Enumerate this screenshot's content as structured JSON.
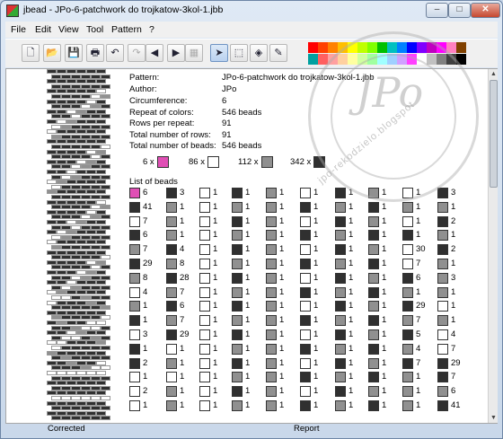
{
  "window": {
    "title": "jbead - JPo-6-patchwork do trojkatow-3kol-1.jbb",
    "min": "–",
    "max": "□",
    "close": "✕"
  },
  "menu": [
    {
      "label": "File"
    },
    {
      "label": "Edit"
    },
    {
      "label": "View"
    },
    {
      "label": "Tool"
    },
    {
      "label": "Pattern"
    },
    {
      "label": "?"
    }
  ],
  "toolbar": [
    {
      "name": "new-icon",
      "glyph": "🗋"
    },
    {
      "name": "open-icon",
      "glyph": "📂"
    },
    {
      "name": "save-icon",
      "glyph": "💾"
    },
    {
      "name": "print-icon",
      "glyph": "🖶"
    },
    {
      "name": "undo-icon",
      "glyph": "↶"
    },
    {
      "name": "redo-icon",
      "glyph": "↷"
    },
    {
      "name": "scroll-left-icon",
      "glyph": "◀"
    },
    {
      "name": "scroll-right-icon",
      "glyph": "▶"
    },
    {
      "name": "arrange-icon",
      "glyph": "▦"
    },
    {
      "name": "pointer-icon",
      "glyph": "➤"
    },
    {
      "name": "select-icon",
      "glyph": "⬚"
    },
    {
      "name": "fill-icon",
      "glyph": "◈"
    },
    {
      "name": "pipette-icon",
      "glyph": "✎"
    }
  ],
  "palette": [
    "#ff0000",
    "#ff4000",
    "#ff8000",
    "#ffbf00",
    "#ffff00",
    "#bfff00",
    "#80ff00",
    "#00c000",
    "#00c0c0",
    "#0080ff",
    "#0000ff",
    "#8000ff",
    "#c000c0",
    "#ff00ff",
    "#ff80c0",
    "#804000",
    "#00a0a0",
    "#ff6060",
    "#ffa0a0",
    "#ffd0a0",
    "#ffffa0",
    "#d0ffa0",
    "#a0ffa0",
    "#a0ffff",
    "#a0d0ff",
    "#d0a0ff",
    "#ff40ff",
    "#ffffff",
    "#c0c0c0",
    "#808080",
    "#404040",
    "#000000"
  ],
  "info": {
    "pattern_label": "Pattern:",
    "pattern": "JPo-6-patchwork do trojkatow-3kol-1.jbb",
    "author_label": "Author:",
    "author": "JPo",
    "circ_label": "Circumference:",
    "circ": "6",
    "repeat_label": "Repeat of colors:",
    "repeat": "546 beads",
    "rows_repeat_label": "Rows per repeat:",
    "rows_repeat": "91",
    "total_rows_label": "Total number of rows:",
    "total_rows": "91",
    "total_beads_label": "Total number of beads:",
    "total_beads": "546 beads"
  },
  "usage": [
    {
      "count": "6 x",
      "color": "#e04fb5"
    },
    {
      "count": "86 x",
      "color": "#ffffff"
    },
    {
      "count": "112 x",
      "color": "#909090"
    },
    {
      "count": "342 x",
      "color": "#303030"
    }
  ],
  "list_title": "List of beads",
  "bead_list": [
    [
      [
        "m",
        "6"
      ],
      [
        "k",
        "41"
      ],
      [
        "w",
        "7"
      ],
      [
        "k",
        "6"
      ],
      [
        "g",
        "7"
      ],
      [
        "k",
        "29"
      ],
      [
        "g",
        "8"
      ],
      [
        "w",
        "4"
      ],
      [
        "g",
        "1"
      ],
      [
        "k",
        "1"
      ],
      [
        "w",
        "3"
      ],
      [
        "k",
        "1"
      ],
      [
        "k",
        "2"
      ],
      [
        "w",
        "1"
      ],
      [
        "w",
        "2"
      ],
      [
        "w",
        "1"
      ]
    ],
    [
      [
        "k",
        "3"
      ],
      [
        "g",
        "1"
      ],
      [
        "g",
        "1"
      ],
      [
        "g",
        "1"
      ],
      [
        "k",
        "4"
      ],
      [
        "g",
        "8"
      ],
      [
        "k",
        "28"
      ],
      [
        "g",
        "7"
      ],
      [
        "k",
        "6"
      ],
      [
        "g",
        "7"
      ],
      [
        "k",
        "29"
      ],
      [
        "w",
        "1"
      ],
      [
        "g",
        "1"
      ],
      [
        "w",
        "1"
      ],
      [
        "g",
        "1"
      ],
      [
        "g",
        "1"
      ]
    ],
    [
      [
        "w",
        "1"
      ],
      [
        "w",
        "1"
      ],
      [
        "w",
        "1"
      ],
      [
        "w",
        "1"
      ],
      [
        "w",
        "1"
      ],
      [
        "w",
        "1"
      ],
      [
        "w",
        "1"
      ],
      [
        "w",
        "1"
      ],
      [
        "w",
        "1"
      ],
      [
        "w",
        "1"
      ],
      [
        "w",
        "1"
      ],
      [
        "w",
        "1"
      ],
      [
        "w",
        "1"
      ],
      [
        "w",
        "1"
      ],
      [
        "w",
        "1"
      ],
      [
        "w",
        "1"
      ]
    ],
    [
      [
        "k",
        "1"
      ],
      [
        "g",
        "1"
      ],
      [
        "k",
        "1"
      ],
      [
        "g",
        "1"
      ],
      [
        "k",
        "1"
      ],
      [
        "g",
        "1"
      ],
      [
        "k",
        "1"
      ],
      [
        "g",
        "1"
      ],
      [
        "k",
        "1"
      ],
      [
        "g",
        "1"
      ],
      [
        "k",
        "1"
      ],
      [
        "g",
        "1"
      ],
      [
        "k",
        "1"
      ],
      [
        "g",
        "1"
      ],
      [
        "k",
        "1"
      ],
      [
        "g",
        "1"
      ]
    ],
    [
      [
        "g",
        "1"
      ],
      [
        "g",
        "1"
      ],
      [
        "g",
        "1"
      ],
      [
        "g",
        "1"
      ],
      [
        "g",
        "1"
      ],
      [
        "g",
        "1"
      ],
      [
        "g",
        "1"
      ],
      [
        "g",
        "1"
      ],
      [
        "g",
        "1"
      ],
      [
        "g",
        "1"
      ],
      [
        "g",
        "1"
      ],
      [
        "g",
        "1"
      ],
      [
        "g",
        "1"
      ],
      [
        "g",
        "1"
      ],
      [
        "g",
        "1"
      ],
      [
        "g",
        "1"
      ]
    ],
    [
      [
        "w",
        "1"
      ],
      [
        "k",
        "1"
      ],
      [
        "w",
        "1"
      ],
      [
        "k",
        "1"
      ],
      [
        "w",
        "1"
      ],
      [
        "k",
        "1"
      ],
      [
        "w",
        "1"
      ],
      [
        "k",
        "1"
      ],
      [
        "w",
        "1"
      ],
      [
        "k",
        "1"
      ],
      [
        "w",
        "1"
      ],
      [
        "k",
        "1"
      ],
      [
        "w",
        "1"
      ],
      [
        "k",
        "1"
      ],
      [
        "w",
        "1"
      ],
      [
        "k",
        "1"
      ]
    ],
    [
      [
        "k",
        "1"
      ],
      [
        "g",
        "1"
      ],
      [
        "k",
        "1"
      ],
      [
        "g",
        "1"
      ],
      [
        "k",
        "1"
      ],
      [
        "g",
        "1"
      ],
      [
        "k",
        "1"
      ],
      [
        "g",
        "1"
      ],
      [
        "k",
        "1"
      ],
      [
        "g",
        "1"
      ],
      [
        "k",
        "1"
      ],
      [
        "g",
        "1"
      ],
      [
        "k",
        "1"
      ],
      [
        "g",
        "1"
      ],
      [
        "k",
        "1"
      ],
      [
        "g",
        "1"
      ]
    ],
    [
      [
        "g",
        "1"
      ],
      [
        "k",
        "1"
      ],
      [
        "g",
        "1"
      ],
      [
        "k",
        "1"
      ],
      [
        "g",
        "1"
      ],
      [
        "k",
        "1"
      ],
      [
        "g",
        "1"
      ],
      [
        "k",
        "1"
      ],
      [
        "g",
        "1"
      ],
      [
        "k",
        "1"
      ],
      [
        "g",
        "1"
      ],
      [
        "k",
        "1"
      ],
      [
        "g",
        "1"
      ],
      [
        "k",
        "1"
      ],
      [
        "g",
        "1"
      ],
      [
        "k",
        "1"
      ]
    ],
    [
      [
        "w",
        "1"
      ],
      [
        "g",
        "1"
      ],
      [
        "w",
        "1"
      ],
      [
        "k",
        "1"
      ],
      [
        "w",
        "30"
      ],
      [
        "w",
        "7"
      ],
      [
        "k",
        "6"
      ],
      [
        "g",
        "1"
      ],
      [
        "k",
        "29"
      ],
      [
        "g",
        "7"
      ],
      [
        "k",
        "5"
      ],
      [
        "g",
        "4"
      ],
      [
        "k",
        "7"
      ],
      [
        "g",
        "1"
      ],
      [
        "g",
        "1"
      ],
      [
        "g",
        "1"
      ]
    ],
    [
      [
        "k",
        "3"
      ],
      [
        "g",
        "1"
      ],
      [
        "k",
        "2"
      ],
      [
        "g",
        "1"
      ],
      [
        "k",
        "2"
      ],
      [
        "g",
        "1"
      ],
      [
        "g",
        "3"
      ],
      [
        "g",
        "1"
      ],
      [
        "w",
        "1"
      ],
      [
        "g",
        "1"
      ],
      [
        "w",
        "4"
      ],
      [
        "w",
        "7"
      ],
      [
        "k",
        "29"
      ],
      [
        "k",
        "7"
      ],
      [
        "g",
        "6"
      ],
      [
        "k",
        "41"
      ]
    ]
  ],
  "bottom": {
    "corrected": "Corrected",
    "report": "Report"
  },
  "watermark": {
    "text": "JPo",
    "url": "jpo-rekodzielo.blogspot"
  }
}
